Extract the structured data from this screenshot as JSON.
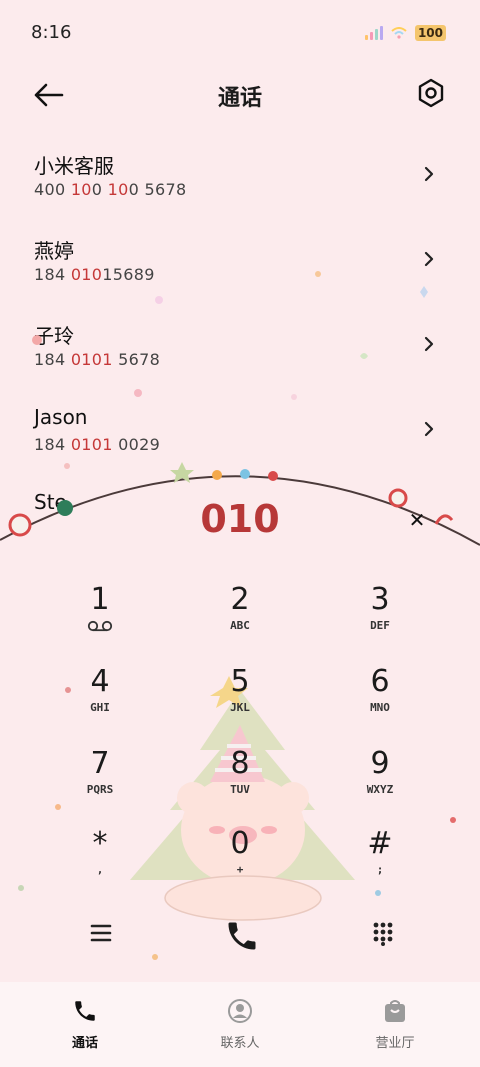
{
  "status_bar": {
    "time": "8:16",
    "battery": "100"
  },
  "header": {
    "title": "通话"
  },
  "contacts": [
    {
      "name": "小米客服",
      "number_parts": [
        "400 ",
        "10",
        "0 ",
        "10",
        "0 5678"
      ]
    },
    {
      "name": "燕婷",
      "number_parts": [
        "184 ",
        "010",
        "15689"
      ]
    },
    {
      "name": "子玲",
      "number_parts": [
        "184 ",
        "0101",
        " 5678"
      ]
    },
    {
      "name": "Jason",
      "number_parts": [
        "184 ",
        "0101",
        " 0029"
      ]
    },
    {
      "name": "Ste",
      "number_parts": []
    }
  ],
  "dialer": {
    "input": "010",
    "keys": [
      {
        "digit": "1",
        "letters": ""
      },
      {
        "digit": "2",
        "letters": "ABC"
      },
      {
        "digit": "3",
        "letters": "DEF"
      },
      {
        "digit": "4",
        "letters": "GHI"
      },
      {
        "digit": "5",
        "letters": "JKL"
      },
      {
        "digit": "6",
        "letters": "MNO"
      },
      {
        "digit": "7",
        "letters": "PQRS"
      },
      {
        "digit": "8",
        "letters": "TUV"
      },
      {
        "digit": "9",
        "letters": "WXYZ"
      },
      {
        "digit": "*",
        "letters": ","
      },
      {
        "digit": "0",
        "letters": "+"
      },
      {
        "digit": "#",
        "letters": ";"
      }
    ]
  },
  "tabs": [
    {
      "label": "通话",
      "icon": "phone-icon",
      "active": true
    },
    {
      "label": "联系人",
      "icon": "person-icon",
      "active": false
    },
    {
      "label": "营业厅",
      "icon": "bag-icon",
      "active": false
    }
  ],
  "colors": {
    "accent": "#c53838",
    "background": "#fcebed"
  }
}
